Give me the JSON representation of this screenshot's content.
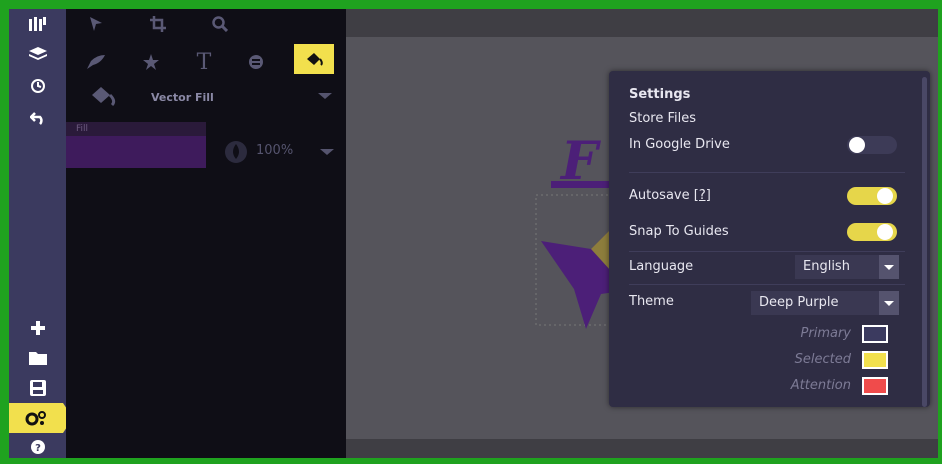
{
  "settings": {
    "title": "Settings",
    "store_files_label": "Store Files",
    "google_drive_label": "In Google Drive",
    "google_drive_on": false,
    "autosave_label": "Autosave",
    "autosave_help": "[?]",
    "autosave_on": true,
    "snap_label": "Snap To Guides",
    "snap_on": true,
    "language_label": "Language",
    "language_value": "English",
    "theme_label": "Theme",
    "theme_value": "Deep Purple",
    "colors": {
      "primary_label": "Primary",
      "primary_color": "#3b3a5f",
      "selected_label": "Selected",
      "selected_color": "#f2e04d",
      "attention_label": "Attention",
      "attention_color": "#f04b4b"
    }
  },
  "tools": {
    "fill_type": "Vector Fill",
    "fill_header": "Fill",
    "fill_color": "#3e1b5c",
    "opacity_value": "100%"
  },
  "theme_colors": {
    "rail": "#3b3a5f",
    "accent": "#f2e04d",
    "frame": "#1fa21f"
  }
}
